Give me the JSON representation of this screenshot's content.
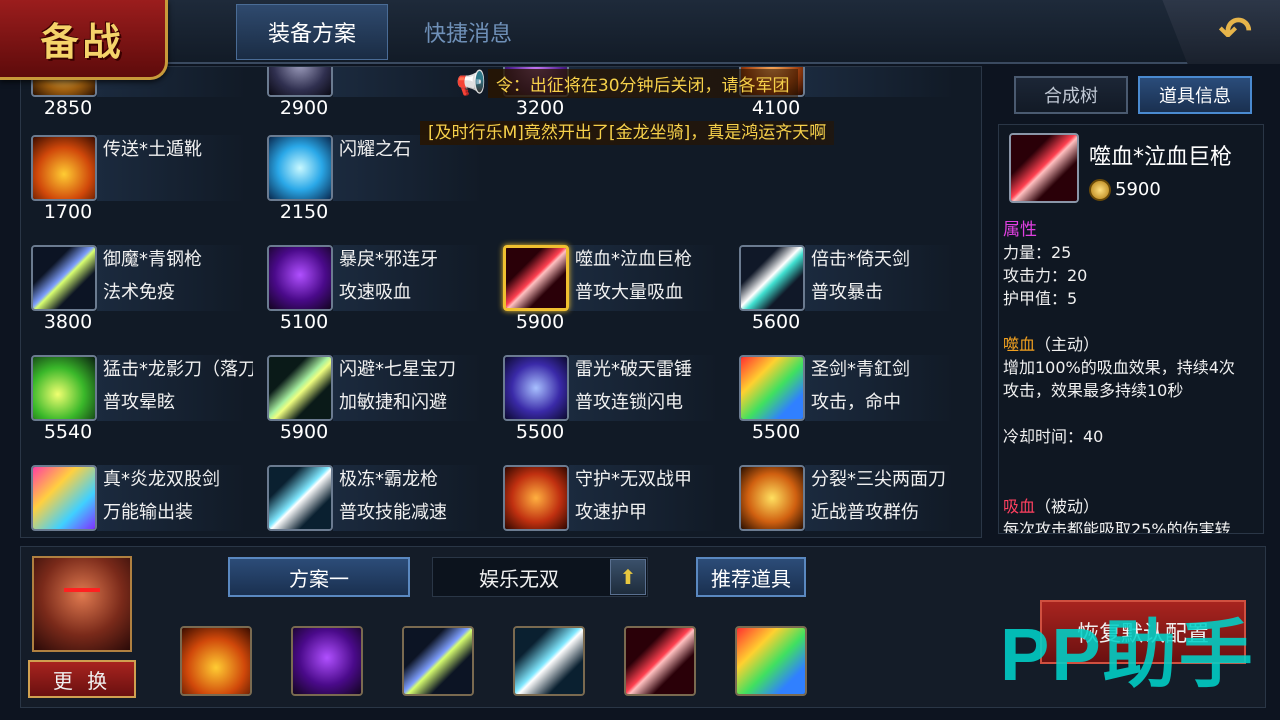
{
  "header": {
    "badge": "备战",
    "tabs": [
      {
        "label": "装备方案",
        "active": true
      },
      {
        "label": "快捷消息",
        "active": false
      }
    ],
    "back_icon": "undo-arrow-icon"
  },
  "announcements": {
    "line1": "令：出征将在30分钟后关闭，请各军团",
    "line2": "[及时行乐M]竟然开出了[金龙坐骑]，真是鸿运齐天啊"
  },
  "items": [
    {
      "name": "",
      "desc": "",
      "price": "2850",
      "icon": "gold-item-icon"
    },
    {
      "name": "",
      "desc": "",
      "price": "2900",
      "icon": "dark-item-icon"
    },
    {
      "name": "",
      "desc": "",
      "price": "3200",
      "icon": "purple-item-icon"
    },
    {
      "name": "",
      "desc": "",
      "price": "4100",
      "icon": "orange-item-icon"
    },
    {
      "name": "传送*土遁靴",
      "desc": "",
      "price": "1700",
      "icon": "boot-icon"
    },
    {
      "name": "闪耀之石",
      "desc": "",
      "price": "2150",
      "icon": "gem-icon"
    },
    {
      "name": "御魔*青钢枪",
      "desc": "法术免疫",
      "price": "3800",
      "icon": "spear-blue-icon"
    },
    {
      "name": "暴戾*邪连牙",
      "desc": "攻速吸血",
      "price": "5100",
      "icon": "fang-icon"
    },
    {
      "name": "噬血*泣血巨枪",
      "desc": "普攻大量吸血",
      "price": "5900",
      "icon": "spear-red-icon",
      "selected": true
    },
    {
      "name": "倍击*倚天剑",
      "desc": "普攻暴击",
      "price": "5600",
      "icon": "sword-white-icon"
    },
    {
      "name": "猛击*龙影刀（落刀式",
      "desc": "普攻晕眩",
      "price": "5540",
      "icon": "blade-green-icon"
    },
    {
      "name": "闪避*七星宝刀",
      "desc": "加敏捷和闪避",
      "price": "5900",
      "icon": "dart-icon"
    },
    {
      "name": "雷光*破天雷锤",
      "desc": "普攻连锁闪电",
      "price": "5500",
      "icon": "hammer-icon"
    },
    {
      "name": "圣剑*青釭剑",
      "desc": "攻击，命中",
      "price": "5500",
      "icon": "sword-rainbow-icon"
    },
    {
      "name": "真*炎龙双股剑",
      "desc": "万能输出装",
      "price": "",
      "icon": "dual-sword-icon"
    },
    {
      "name": "极冻*霸龙枪",
      "desc": "普攻技能减速",
      "price": "",
      "icon": "ice-spear-icon"
    },
    {
      "name": "守护*无双战甲",
      "desc": "攻速护甲",
      "price": "",
      "icon": "armor-icon"
    },
    {
      "name": "分裂*三尖两面刀",
      "desc": "近战普攻群伤",
      "price": "",
      "icon": "trident-icon"
    }
  ],
  "right_tabs": [
    {
      "label": "合成树",
      "active": false
    },
    {
      "label": "道具信息",
      "active": true
    }
  ],
  "detail": {
    "name": "噬血*泣血巨枪",
    "price": "5900",
    "icon": "spear-red-icon",
    "attr_head": "属性",
    "attrs": [
      "力量：25",
      "攻击力：20",
      "护甲值：5"
    ],
    "active_skill": {
      "name": "噬血",
      "type": "（主动）"
    },
    "active_desc1": "增加100%的吸血效果，持续4次",
    "active_desc2": "攻击，效果最多持续10秒",
    "cooldown": "冷却时间：40",
    "passive_skill": {
      "name": "吸血",
      "type": "（被动）"
    },
    "passive_desc": "每次攻击都能吸取25%的伤害转"
  },
  "bottom": {
    "replace_label": "更 换",
    "plan_label": "方案一",
    "mode_label": "娱乐无双",
    "recommend_label": "推荐道具",
    "reset_label": "恢复默认配置",
    "slots": [
      "boot-icon",
      "fang-icon",
      "spear-blue-icon",
      "ice-spear-icon",
      "spear-red-icon",
      "sword-rainbow-icon"
    ]
  },
  "watermark": "PP助手"
}
